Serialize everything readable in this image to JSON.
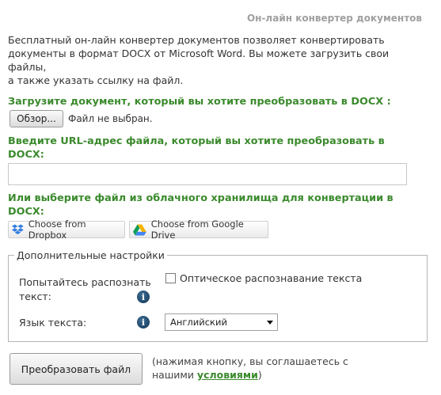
{
  "header": {
    "title": "Он-лайн конвертер документов"
  },
  "intro": {
    "lines": [
      "Бесплатный он-лайн конвертер документов позволяет конвертировать",
      "документы в формат DOCX от Microsoft Word. Вы можете загрузить свои файлы,",
      "а также указать ссылку на файл."
    ]
  },
  "upload": {
    "label": "Загрузите документ, который вы хотите преобразовать в DOCX :",
    "browse_button": "Обзор...",
    "no_file_text": "Файл не выбран."
  },
  "url": {
    "label_line1": "Введите URL-адрес файла, который вы хотите преобразовать в",
    "label_line2": "DOCX:",
    "value": ""
  },
  "cloud": {
    "label_line1": "Или выберите файл из облачного хранилища для конвертации в",
    "label_line2": "DOCX:",
    "dropbox_button": "Choose from Dropbox",
    "gdrive_button": "Choose from Google Drive"
  },
  "settings": {
    "legend": "Дополнительные настройки",
    "ocr_prompt_line1": "Попытайтесь распознать",
    "ocr_prompt_line2": "текст:",
    "ocr_checkbox_label": "Оптическое распознавание текста",
    "ocr_checked": false,
    "language_label": "Язык текста:",
    "language_selected": "Английский",
    "info_glyph": "i"
  },
  "actions": {
    "convert_button": "Преобразовать файл",
    "consent_text_line1": "(нажимая кнопку, вы соглашаетесь с",
    "consent_text_prefix": "нашими ",
    "consent_link": "условиями",
    "consent_suffix": ")"
  },
  "colors": {
    "accent_green": "#3b8a2d",
    "header_gray": "#a0a0a0",
    "info_icon_blue": "#0f3557",
    "dropbox_blue": "#2f7de1"
  }
}
